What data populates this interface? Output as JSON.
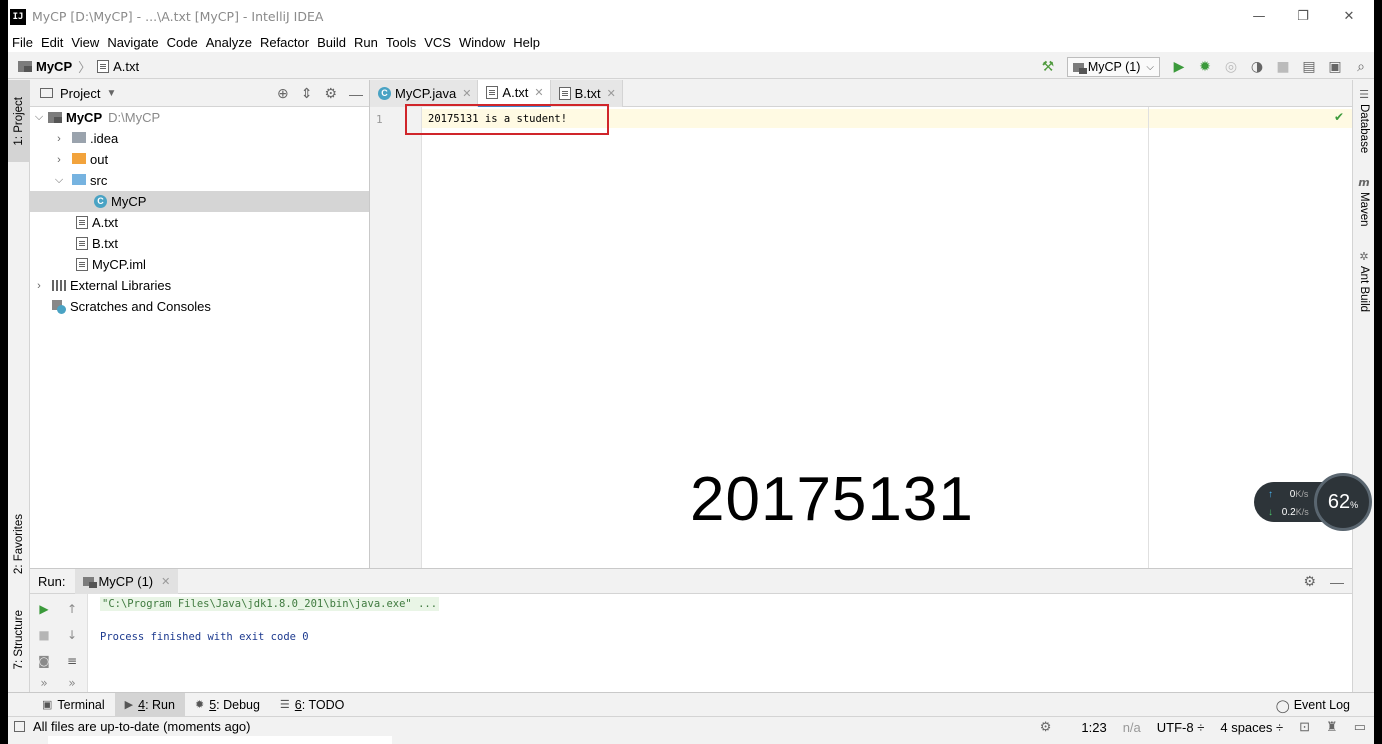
{
  "window": {
    "title": "MyCP [D:\\MyCP] - ...\\A.txt [MyCP] - IntelliJ IDEA",
    "logo_text": "IJ",
    "minimize": "—",
    "restore": "❐",
    "close": "✕"
  },
  "menu": [
    "File",
    "Edit",
    "View",
    "Navigate",
    "Code",
    "Analyze",
    "Refactor",
    "Build",
    "Run",
    "Tools",
    "VCS",
    "Window",
    "Help"
  ],
  "navbar": {
    "project": "MyCP",
    "file": "A.txt",
    "run_config": "MyCP (1)"
  },
  "left_stripe": {
    "project_tab": "1: Project",
    "favorites_tab": "2: Favorites",
    "structure_tab": "7: Structure"
  },
  "project_panel": {
    "title": "Project",
    "tree": [
      {
        "label": "MyCP",
        "extra": "D:\\MyCP"
      },
      {
        "label": ".idea"
      },
      {
        "label": "out"
      },
      {
        "label": "src"
      },
      {
        "label": "MyCP"
      },
      {
        "label": "A.txt"
      },
      {
        "label": "B.txt"
      },
      {
        "label": "MyCP.iml"
      },
      {
        "label": "External Libraries"
      },
      {
        "label": "Scratches and Consoles"
      }
    ]
  },
  "editor": {
    "tabs": [
      {
        "label": "MyCP.java"
      },
      {
        "label": "A.txt"
      },
      {
        "label": "B.txt"
      }
    ],
    "line_number": "1",
    "code": "20175131 is a student!",
    "overlay_text": "20175131"
  },
  "right_stripe": {
    "database": "Database",
    "maven": "Maven",
    "ant": "Ant Build"
  },
  "net_widget": {
    "up": "0",
    "up_unit": "K/s",
    "down": "0.2",
    "down_unit": "K/s",
    "percent": "62",
    "percent_unit": "%"
  },
  "run_panel": {
    "label": "Run:",
    "tab": "MyCP (1)",
    "line1": "\"C:\\Program Files\\Java\\jdk1.8.0_201\\bin\\java.exe\" ...",
    "line2": "Process finished with exit code 0"
  },
  "bottom_tabs": {
    "terminal": "Terminal",
    "run_key": "4",
    "run": ": Run",
    "debug_key": "5",
    "debug": ": Debug",
    "todo_key": "6",
    "todo": ": TODO",
    "event_log": "Event Log"
  },
  "status": {
    "message": "All files are up-to-date (moments ago)",
    "position": "1:23",
    "na": "n/a",
    "encoding": "UTF-8 ÷",
    "indent": "4 spaces ÷"
  }
}
